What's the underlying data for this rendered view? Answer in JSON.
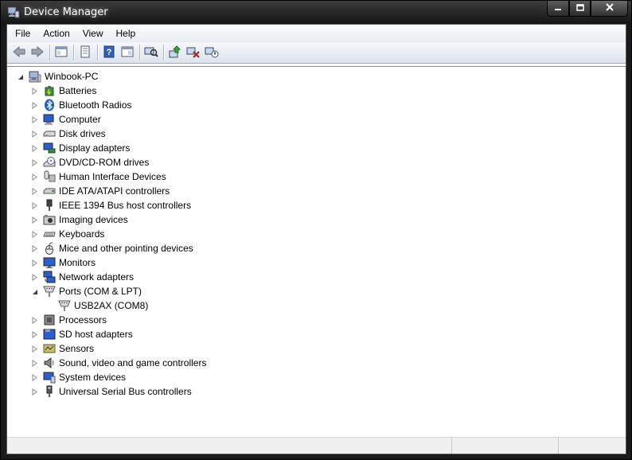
{
  "window": {
    "title": "Device Manager"
  },
  "caption": {
    "minimize": "minimize-icon",
    "maximize": "maximize-icon",
    "close": "close-icon"
  },
  "menu": [
    {
      "label": "File"
    },
    {
      "label": "Action"
    },
    {
      "label": "View"
    },
    {
      "label": "Help"
    }
  ],
  "toolbar": [
    "back-icon",
    "forward-icon",
    "show-hide-console-tree-icon",
    "properties-icon",
    "help-icon",
    "show-action-pane-icon",
    "scan-hardware-icon",
    "update-driver-icon",
    "uninstall-icon",
    "disable-device-icon"
  ],
  "tree": {
    "root": "Winbook-PC",
    "categories": [
      {
        "label": "Batteries",
        "icon": "battery-icon"
      },
      {
        "label": "Bluetooth Radios",
        "icon": "bluetooth-icon"
      },
      {
        "label": "Computer",
        "icon": "computer-icon"
      },
      {
        "label": "Disk drives",
        "icon": "disk-drive-icon"
      },
      {
        "label": "Display adapters",
        "icon": "display-adapter-icon"
      },
      {
        "label": "DVD/CD-ROM drives",
        "icon": "dvd-drive-icon"
      },
      {
        "label": "Human Interface Devices",
        "icon": "hid-icon"
      },
      {
        "label": "IDE ATA/ATAPI controllers",
        "icon": "ide-controller-icon"
      },
      {
        "label": "IEEE 1394 Bus host controllers",
        "icon": "ieee1394-icon"
      },
      {
        "label": "Imaging devices",
        "icon": "camera-icon"
      },
      {
        "label": "Keyboards",
        "icon": "keyboard-icon"
      },
      {
        "label": "Mice and other pointing devices",
        "icon": "mouse-icon"
      },
      {
        "label": "Monitors",
        "icon": "monitor-icon"
      },
      {
        "label": "Network adapters",
        "icon": "network-adapter-icon"
      },
      {
        "label": "Ports (COM & LPT)",
        "icon": "port-icon",
        "expanded": true,
        "children": [
          {
            "label": "USB2AX (COM8)",
            "icon": "port-icon"
          }
        ]
      },
      {
        "label": "Processors",
        "icon": "processor-icon"
      },
      {
        "label": "SD host adapters",
        "icon": "sd-card-icon"
      },
      {
        "label": "Sensors",
        "icon": "sensor-icon"
      },
      {
        "label": "Sound, video and game controllers",
        "icon": "speaker-icon"
      },
      {
        "label": "System devices",
        "icon": "system-devices-icon"
      },
      {
        "label": "Universal Serial Bus controllers",
        "icon": "usb-icon"
      }
    ]
  },
  "colors": {
    "titlebar": "#1f1f1f",
    "toolbar": "#dde4ee",
    "accent": "#3a7bd5"
  }
}
